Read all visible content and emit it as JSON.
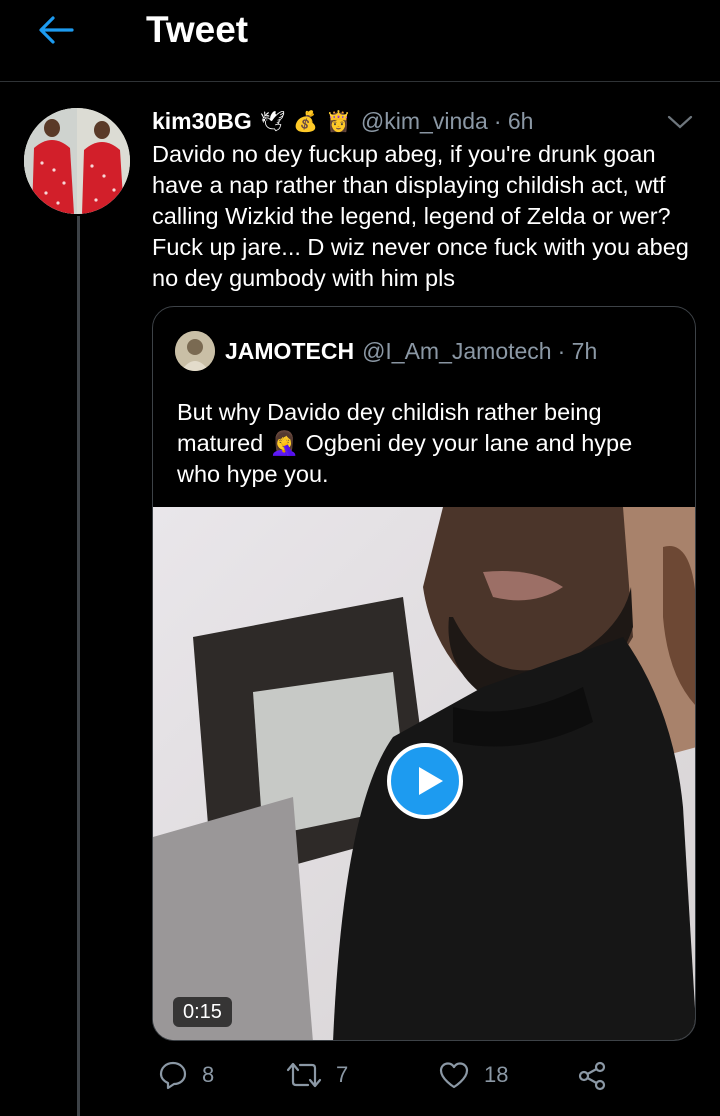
{
  "header": {
    "title": "Tweet"
  },
  "tweet": {
    "display_name": "kim30BG",
    "name_emojis": [
      "🕊",
      "💰",
      "👸"
    ],
    "handle": "@kim_vinda",
    "time": "· 6h",
    "text": "Davido no dey fuckup abeg, if you're drunk goan\nhave a nap rather than displaying childish act, wtf\ncalling Wizkid the legend, legend of Zelda or wer?\nFuck up jare... D wiz never once fuck with you abeg\nno dey gumbody with him pls"
  },
  "quote": {
    "display_name": "JAMOTECH",
    "handle": "@I_Am_Jamotech",
    "time": "· 7h",
    "text_before_emoji": "But why Davido dey childish rather being\nmatured ",
    "emoji": "🤦‍♀️",
    "text_after_emoji": " Ogbeni dey your lane and hype\nwho hype you.",
    "video_duration": "0:15"
  },
  "actions": {
    "replies": "8",
    "retweets": "7",
    "likes": "18"
  },
  "colors": {
    "background": "#000000",
    "accent": "#1d9bf0",
    "secondary_text": "#8b98a5",
    "border": "#3d4247"
  }
}
